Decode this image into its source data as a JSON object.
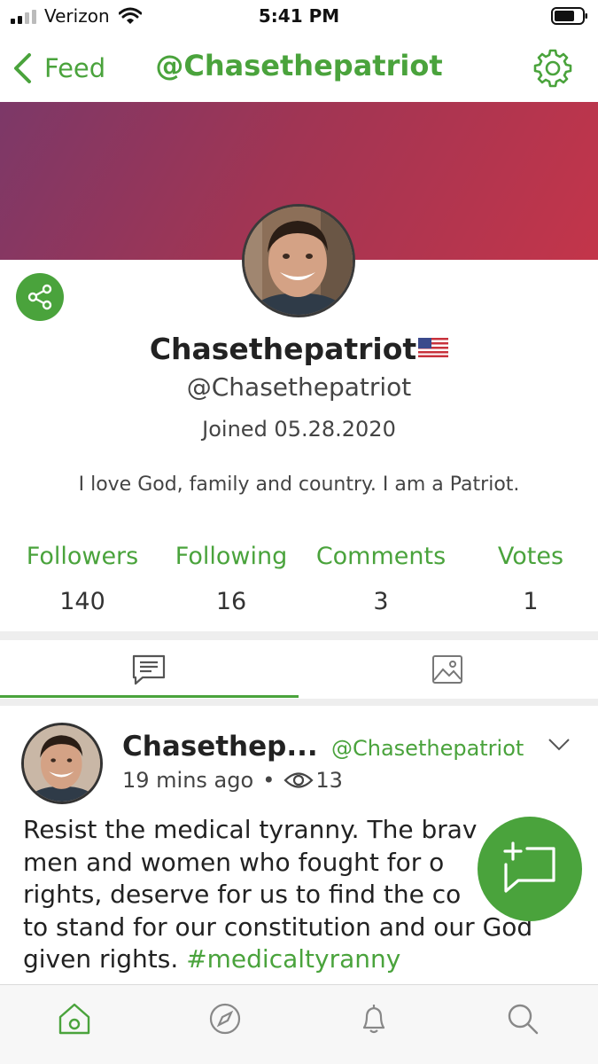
{
  "status_bar": {
    "carrier": "Verizon",
    "time": "5:41 PM"
  },
  "nav": {
    "back_label": "Feed",
    "title": "@Chasethepatriot",
    "settings_icon": "gear-icon"
  },
  "profile": {
    "display_name": "Chasethepatriot",
    "flag_icon": "us-flag-icon",
    "handle": "@Chasethepatriot",
    "joined": "Joined 05.28.2020",
    "bio": "I love God, family and country. I am a Patriot."
  },
  "stats": [
    {
      "label": "Followers",
      "value": "140"
    },
    {
      "label": "Following",
      "value": "16"
    },
    {
      "label": "Comments",
      "value": "3"
    },
    {
      "label": "Votes",
      "value": "1"
    }
  ],
  "tabs": [
    {
      "icon": "posts-icon",
      "active": true
    },
    {
      "icon": "photos-icon",
      "active": false
    }
  ],
  "post": {
    "author_name": "Chasethep...",
    "author_handle": "@Chasethepatriot",
    "time_ago": "19 mins ago",
    "separator": "•",
    "views": "13",
    "body_lines": [
      "Resist the medical tyranny. The brav",
      "men and women who fought for o",
      "rights, deserve for us to find the co",
      "to stand for our constitution and our God",
      "given rights. "
    ],
    "hashtag": "#medicaltyranny"
  },
  "bottom_nav": [
    "home-icon",
    "compass-icon",
    "bell-icon",
    "search-icon"
  ],
  "colors": {
    "accent": "#4aa33c",
    "banner_start": "#7c3868",
    "banner_end": "#c3354a"
  }
}
